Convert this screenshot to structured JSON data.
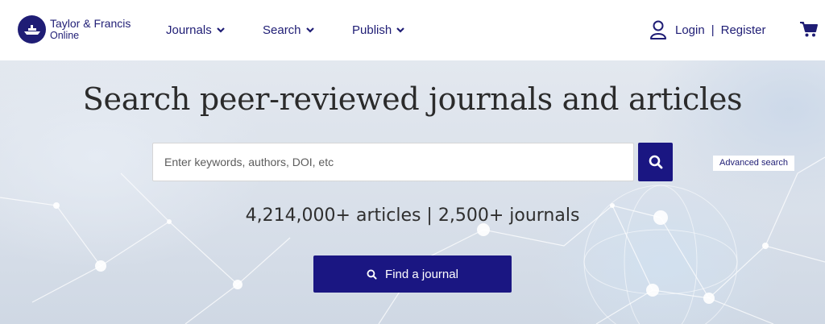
{
  "brand": {
    "name_line1": "Taylor & Francis",
    "name_line2": "Online",
    "color": "#1f1d75"
  },
  "nav": {
    "journals": "Journals",
    "search": "Search",
    "publish": "Publish"
  },
  "account": {
    "login": "Login",
    "separator": "|",
    "register": "Register",
    "icon": "user-icon",
    "cart_icon": "cart-icon"
  },
  "hero": {
    "title": "Search peer-reviewed journals and articles",
    "search_placeholder": "Enter keywords, authors, DOI, etc",
    "advanced_search": "Advanced search",
    "stats": "4,214,000+ articles | 2,500+ journals",
    "find_journal": "Find a journal",
    "accent_color": "#1a1682"
  }
}
